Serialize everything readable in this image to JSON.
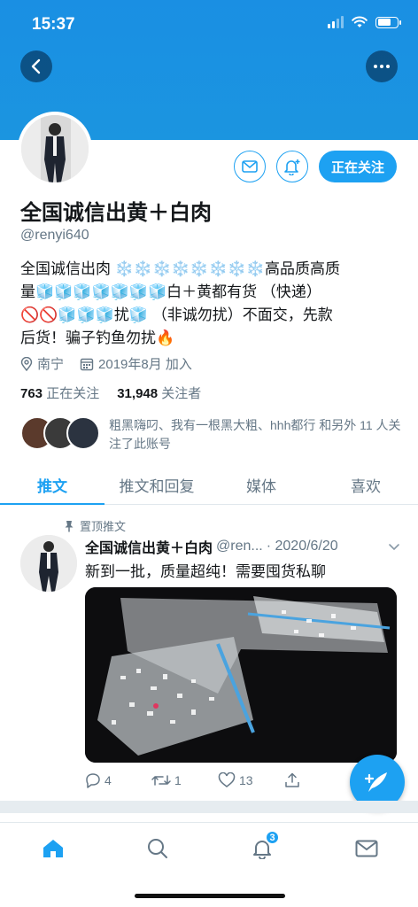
{
  "status_bar": {
    "time": "15:37"
  },
  "profile": {
    "name": "全国诚信出黄＋白肉",
    "handle": "@renyi640",
    "bio_line1": "全国诚信出肉 ❄️❄️❄️❄️❄️❄️❄️❄️高品质高质",
    "bio_line2": "量🧊🧊🧊🧊🧊🧊🧊白＋黄都有货 （快递）",
    "bio_line3": "🚫🚫🧊🧊🧊扰🧊 （非诚勿扰）不面交，先款",
    "bio_line4": "后货！骗子钓鱼勿扰🔥",
    "location": "南宁",
    "joined": "2019年8月 加入",
    "following_count": "763",
    "following_label": "正在关注",
    "followers_count": "31,948",
    "followers_label": "关注者",
    "followed_by_text": "粗黑嗨叼、我有一根黑大粗、hhh都行 和另外 11 人关注了此账号",
    "follow_button": "正在关注"
  },
  "tabs": [
    {
      "label": "推文",
      "active": true
    },
    {
      "label": "推文和回复",
      "active": false
    },
    {
      "label": "媒体",
      "active": false
    },
    {
      "label": "喜欢",
      "active": false
    }
  ],
  "tweet": {
    "pinned_label": "置顶推文",
    "author_name": "全国诚信出黄＋白肉",
    "author_handle": "@ren...",
    "date": "· 2020/6/20",
    "text": "新到一批，质量超纯！需要囤货私聊",
    "reply_count": "4",
    "retweet_count": "1",
    "like_count": "13"
  },
  "bottom_nav": {
    "notification_badge": "3"
  },
  "colors": {
    "accent": "#1da1f2",
    "header": "#1b95e0",
    "muted": "#657786"
  },
  "icons": [
    "back-icon",
    "more-icon",
    "mail-icon",
    "bell-plus-icon",
    "location-icon",
    "calendar-icon",
    "pin-icon",
    "chevron-down-icon",
    "reply-icon",
    "retweet-icon",
    "heart-icon",
    "share-icon",
    "compose-icon",
    "home-icon",
    "search-icon",
    "bell-icon"
  ]
}
